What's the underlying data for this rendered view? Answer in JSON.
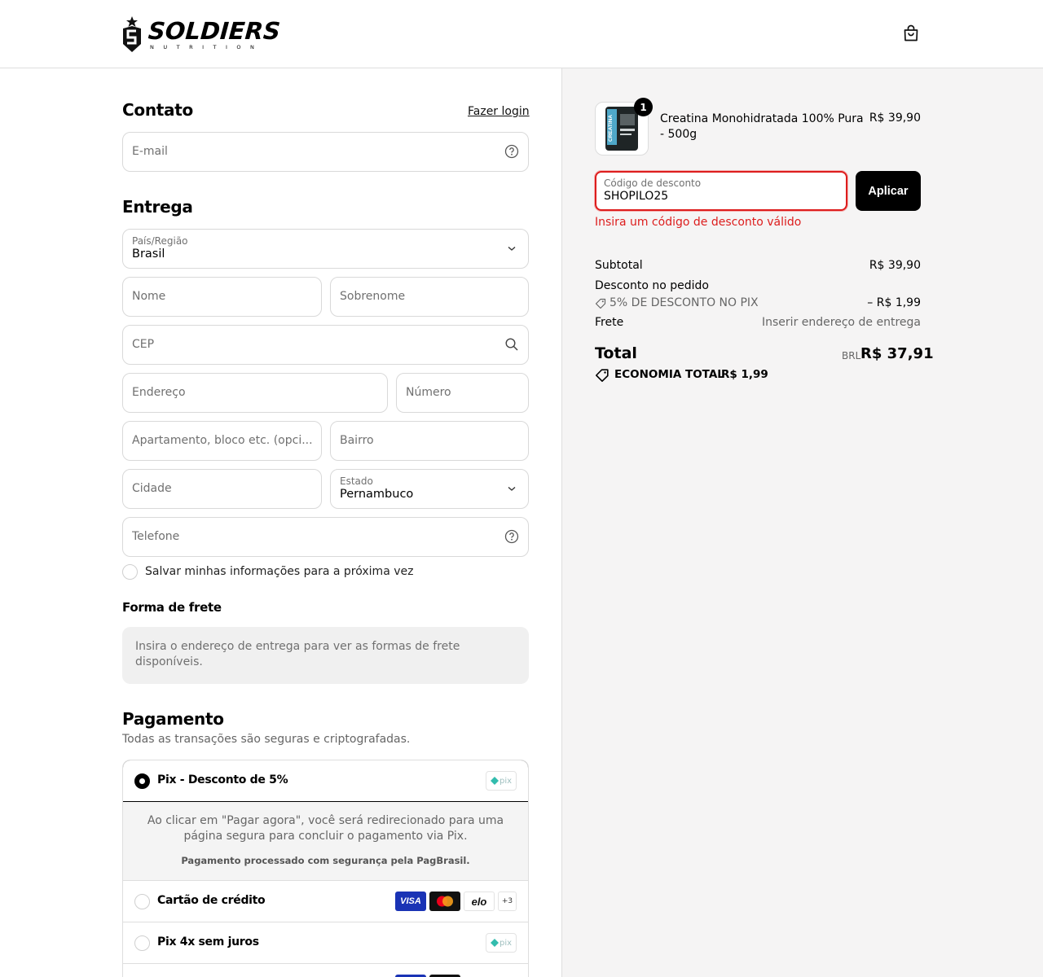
{
  "header": {
    "logo_main": "SOLDIERS",
    "logo_sub": "NUTRITION"
  },
  "contact": {
    "title": "Contato",
    "login_link": "Fazer login",
    "email_placeholder": "E-mail"
  },
  "delivery": {
    "title": "Entrega",
    "country_label": "País/Região",
    "country_value": "Brasil",
    "first_name_placeholder": "Nome",
    "last_name_placeholder": "Sobrenome",
    "cep_placeholder": "CEP",
    "address_placeholder": "Endereço",
    "number_placeholder": "Número",
    "apartment_placeholder": "Apartamento, bloco etc. (opci...",
    "neighborhood_placeholder": "Bairro",
    "city_placeholder": "Cidade",
    "state_label": "Estado",
    "state_value": "Pernambuco",
    "phone_placeholder": "Telefone",
    "save_info_label": "Salvar minhas informações para a próxima vez"
  },
  "shipping": {
    "title": "Forma de frete",
    "info": "Insira o endereço de entrega para ver as formas de frete disponíveis."
  },
  "payment": {
    "title": "Pagamento",
    "subtitle": "Todas as transações são seguras e criptografadas.",
    "pix_label": "Pix - Desconto de 5%",
    "pix_info": "Ao clicar em \"Pagar agora\", você será redirecionado para uma página segura para concluir o pagamento via Pix.",
    "pix_secure": "Pagamento processado com segurança pela PagBrasil.",
    "credit_label": "Cartão de crédito",
    "pix4x_label": "Pix 4x sem juros",
    "card_more": "+3",
    "visa": "VISA",
    "elo": "elo",
    "pix_logo": "pix"
  },
  "summary": {
    "qty": "1",
    "product_name_line1": "Creatina Monohidratada 100% Pura",
    "product_name_line2": "- 500g",
    "product_price": "R$ 39,90",
    "product_image_text": "CREATINA",
    "discount_label": "Código de desconto",
    "discount_value": "SHOPILO25",
    "apply_label": "Aplicar",
    "error": "Insira um código de desconto válido",
    "subtotal_label": "Subtotal",
    "subtotal_value": "R$ 39,90",
    "order_discount_label": "Desconto no pedido",
    "pix_discount_label": "5% DE DESCONTO NO PIX",
    "pix_discount_value": "– R$ 1,99",
    "shipping_label": "Frete",
    "shipping_value": "Inserir endereço de entrega",
    "total_label": "Total",
    "currency": "BRL",
    "total_value": "R$ 37,91",
    "savings_label": "ECONOMIA TOTAL",
    "savings_value": "R$ 1,99"
  },
  "colors": {
    "error": "#dd1d1d",
    "panel_bg": "#f5f4f4",
    "border": "#d9d9d9"
  }
}
